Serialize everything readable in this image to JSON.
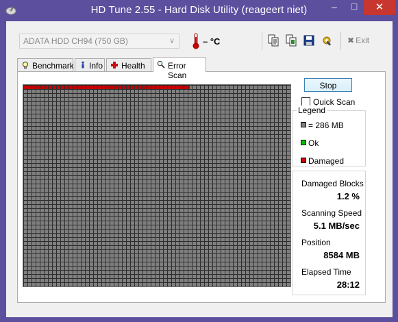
{
  "window": {
    "title": "HD Tune 2.55 - Hard Disk Utility (reageert niet)",
    "minimize": "–",
    "maximize": "□",
    "close": "✕"
  },
  "toolbar": {
    "drive": "ADATA   HDD CH94 (750 GB)",
    "temperature": "– °C",
    "exit_label": "Exit",
    "icons": [
      "thermometer-icon",
      "copy-text-icon",
      "copy-image-icon",
      "save-icon",
      "options-icon",
      "exit-icon"
    ]
  },
  "tabs": [
    {
      "label": "Benchmark",
      "icon": "lightbulb-icon",
      "active": false
    },
    {
      "label": "Info",
      "icon": "info-icon",
      "active": false
    },
    {
      "label": "Health",
      "icon": "health-cross-icon",
      "active": false
    },
    {
      "label": "Error Scan",
      "icon": "magnifier-icon",
      "active": true
    }
  ],
  "scan": {
    "stop_label": "Stop",
    "quick_scan_label": "Quick Scan",
    "quick_scan_checked": false,
    "damaged_fraction": 0.012
  },
  "legend": {
    "title": "Legend",
    "block_size": "= 286 MB",
    "ok": "Ok",
    "damaged": "Damaged"
  },
  "stats": {
    "damaged_blocks_label": "Damaged Blocks",
    "damaged_blocks_value": "1.2 %",
    "speed_label": "Scanning Speed",
    "speed_value": "5.1 MB/sec",
    "position_label": "Position",
    "position_value": "8584 MB",
    "elapsed_label": "Elapsed Time",
    "elapsed_value": "28:12"
  },
  "colors": {
    "titlebar": "#5b4f9e",
    "close_button": "#c7372f",
    "block_ok_scanned": "#7f7f7f",
    "block_damaged": "#c60000",
    "legend_ok": "#00c000",
    "legend_damaged": "#d00000"
  }
}
